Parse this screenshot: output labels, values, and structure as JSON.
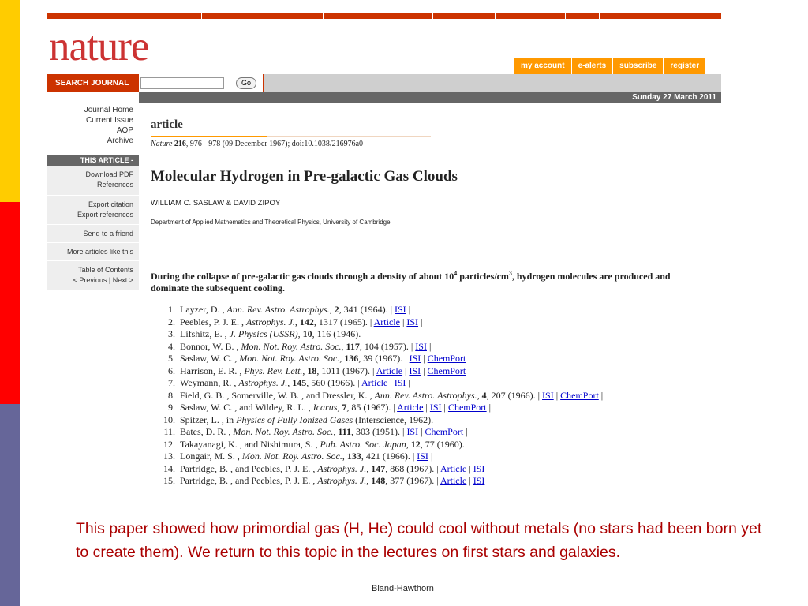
{
  "slide": {
    "caption": "This paper showed how primordial gas (H, He) could cool without metals (no stars had been born yet to create them). We return to this topic in the lectures on first stars and galaxies.",
    "footer": "Bland-Hawthorn",
    "stripe_colors": [
      "#ffcc00",
      "#ff0000",
      "#666699"
    ]
  },
  "site": {
    "logo": "nature",
    "account_links": [
      "my account",
      "e-alerts",
      "subscribe",
      "register"
    ],
    "search_label": "SEARCH JOURNAL",
    "search_value": "",
    "go_label": "Go",
    "date": "Sunday 27 March 2011",
    "journal_nav": [
      "Journal Home",
      "Current Issue",
      "AOP",
      "Archive"
    ],
    "this_article_label": "THIS ARTICLE -",
    "tools": [
      [
        "Download PDF",
        "References"
      ],
      [
        "Export citation",
        "Export references"
      ],
      [
        "Send to a friend"
      ],
      [
        "More articles like this"
      ],
      [
        "Table of Contents",
        "< Previous | Next >"
      ]
    ]
  },
  "article": {
    "section": "article",
    "citation_journal": "Nature",
    "citation_volume": "216",
    "citation_rest": ", 976 - 978 (09 December 1967); doi:10.1038/216976a0",
    "title": "Molecular Hydrogen in Pre-galactic Gas Clouds",
    "authors": "WILLIAM C. SASLAW & DAVID ZIPOY",
    "affiliation": "Department of Applied Mathematics and Theoretical Physics, University of Cambridge",
    "abstract_part1": "During the collapse of pre-galactic gas clouds through a density of about 10",
    "abstract_sup1": "4",
    "abstract_part2": " particles/cm",
    "abstract_sup2": "3",
    "abstract_part3": ", hydrogen molecules are produced and dominate the subsequent cooling."
  },
  "references": [
    {
      "num": "1.",
      "authors": "Layzer, D. , ",
      "journal": "Ann. Rev. Astro. Astrophys.",
      "vol": "2",
      "rest": ", 341 (1964). | ",
      "links": [
        "ISI"
      ]
    },
    {
      "num": "2.",
      "authors": "Peebles, P. J. E. , ",
      "journal": "Astrophys. J.",
      "vol": "142",
      "rest": ", 1317 (1965). | ",
      "links": [
        "Article",
        "ISI"
      ]
    },
    {
      "num": "3.",
      "authors": "Lifshitz, E. , ",
      "journal": "J. Physics (USSR)",
      "vol": "10",
      "rest": ", 116 (1946).",
      "links": []
    },
    {
      "num": "4.",
      "authors": "Bonnor, W. B. , ",
      "journal": "Mon. Not. Roy. Astro. Soc.",
      "vol": "117",
      "rest": ", 104 (1957). | ",
      "links": [
        "ISI"
      ]
    },
    {
      "num": "5.",
      "authors": "Saslaw, W. C. , ",
      "journal": "Mon. Not. Roy. Astro. Soc.",
      "vol": "136",
      "rest": ", 39 (1967). | ",
      "links": [
        "ISI",
        "ChemPort"
      ]
    },
    {
      "num": "6.",
      "authors": "Harrison, E. R. , ",
      "journal": "Phys. Rev. Lett.",
      "vol": "18",
      "rest": ", 1011 (1967). | ",
      "links": [
        "Article",
        "ISI",
        "ChemPort"
      ]
    },
    {
      "num": "7.",
      "authors": "Weymann, R. , ",
      "journal": "Astrophys. J.",
      "vol": "145",
      "rest": ", 560 (1966). | ",
      "links": [
        "Article",
        "ISI"
      ]
    },
    {
      "num": "8.",
      "authors": "Field, G. B. , Somerville, W. B. , and Dressler, K. , ",
      "journal": "Ann. Rev. Astro. Astrophys.",
      "vol": "4",
      "rest": ", 207 (1966). | ",
      "links": [
        "ISI",
        "ChemPort"
      ]
    },
    {
      "num": "9.",
      "authors": "Saslaw, W. C. , and Wildey, R. L. , ",
      "journal": "Icarus",
      "vol": "7",
      "rest": ", 85 (1967). | ",
      "links": [
        "Article",
        "ISI",
        "ChemPort"
      ]
    },
    {
      "num": "10.",
      "authors": "Spitzer, L. , in ",
      "journal": "Physics of Fully Ionized Gases",
      "vol": "",
      "rest": " (Interscience, 1962).",
      "links": []
    },
    {
      "num": "11.",
      "authors": "Bates, D. R. , ",
      "journal": "Mon. Not. Roy. Astro. Soc.",
      "vol": "111",
      "rest": ", 303 (1951). | ",
      "links": [
        "ISI",
        "ChemPort"
      ]
    },
    {
      "num": "12.",
      "authors": "Takayanagi, K. , and Nishimura, S. , ",
      "journal": "Pub. Astro. Soc. Japan",
      "vol": "12",
      "rest": ", 77 (1960).",
      "links": []
    },
    {
      "num": "13.",
      "authors": "Longair, M. S. , ",
      "journal": "Mon. Not. Roy. Astro. Soc.",
      "vol": "133",
      "rest": ", 421 (1966). | ",
      "links": [
        "ISI"
      ]
    },
    {
      "num": "14.",
      "authors": "Partridge, B. , and Peebles, P. J. E. , ",
      "journal": "Astrophys. J.",
      "vol": "147",
      "rest": ", 868 (1967). | ",
      "links": [
        "Article",
        "ISI"
      ]
    },
    {
      "num": "15.",
      "authors": "Partridge, B. , and Peebles, P. J. E. , ",
      "journal": "Astrophys. J.",
      "vol": "148",
      "rest": ", 377 (1967). | ",
      "links": [
        "Article",
        "ISI"
      ]
    }
  ]
}
